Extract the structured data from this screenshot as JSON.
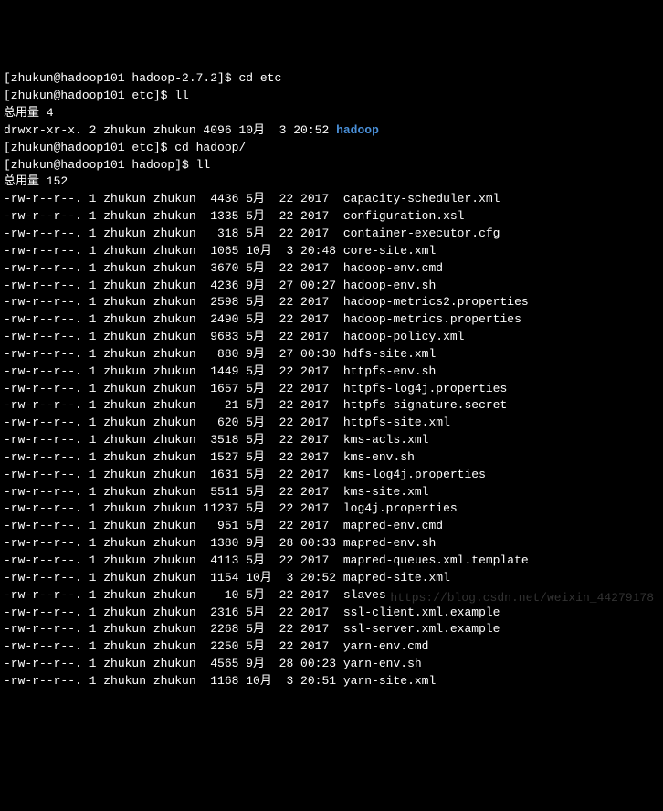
{
  "prompts": [
    {
      "user": "zhukun",
      "host": "hadoop101",
      "path": "hadoop-2.7.2",
      "cmd": "cd etc"
    },
    {
      "user": "zhukun",
      "host": "hadoop101",
      "path": "etc",
      "cmd": "ll"
    }
  ],
  "total1_label": "总用量 4",
  "dir_line": {
    "perm": "drwxr-xr-x.",
    "links": "2",
    "owner": "zhukun",
    "group": "zhukun",
    "size": "4096",
    "month": "10月",
    "day": " 3",
    "time": "20:52",
    "name": "hadoop"
  },
  "prompts2": [
    {
      "user": "zhukun",
      "host": "hadoop101",
      "path": "etc",
      "cmd": "cd hadoop/"
    },
    {
      "user": "zhukun",
      "host": "hadoop101",
      "path": "hadoop",
      "cmd": "ll"
    }
  ],
  "total2_label": "总用量 152",
  "files": [
    {
      "perm": "-rw-r--r--.",
      "links": "1",
      "owner": "zhukun",
      "group": "zhukun",
      "size": " 4436",
      "month": "5月 ",
      "day": "22",
      "time": "2017 ",
      "name": "capacity-scheduler.xml"
    },
    {
      "perm": "-rw-r--r--.",
      "links": "1",
      "owner": "zhukun",
      "group": "zhukun",
      "size": " 1335",
      "month": "5月 ",
      "day": "22",
      "time": "2017 ",
      "name": "configuration.xsl"
    },
    {
      "perm": "-rw-r--r--.",
      "links": "1",
      "owner": "zhukun",
      "group": "zhukun",
      "size": "  318",
      "month": "5月 ",
      "day": "22",
      "time": "2017 ",
      "name": "container-executor.cfg"
    },
    {
      "perm": "-rw-r--r--.",
      "links": "1",
      "owner": "zhukun",
      "group": "zhukun",
      "size": " 1065",
      "month": "10月",
      "day": " 3",
      "time": "20:48",
      "name": "core-site.xml"
    },
    {
      "perm": "-rw-r--r--.",
      "links": "1",
      "owner": "zhukun",
      "group": "zhukun",
      "size": " 3670",
      "month": "5月 ",
      "day": "22",
      "time": "2017 ",
      "name": "hadoop-env.cmd"
    },
    {
      "perm": "-rw-r--r--.",
      "links": "1",
      "owner": "zhukun",
      "group": "zhukun",
      "size": " 4236",
      "month": "9月 ",
      "day": "27",
      "time": "00:27",
      "name": "hadoop-env.sh"
    },
    {
      "perm": "-rw-r--r--.",
      "links": "1",
      "owner": "zhukun",
      "group": "zhukun",
      "size": " 2598",
      "month": "5月 ",
      "day": "22",
      "time": "2017 ",
      "name": "hadoop-metrics2.properties"
    },
    {
      "perm": "-rw-r--r--.",
      "links": "1",
      "owner": "zhukun",
      "group": "zhukun",
      "size": " 2490",
      "month": "5月 ",
      "day": "22",
      "time": "2017 ",
      "name": "hadoop-metrics.properties"
    },
    {
      "perm": "-rw-r--r--.",
      "links": "1",
      "owner": "zhukun",
      "group": "zhukun",
      "size": " 9683",
      "month": "5月 ",
      "day": "22",
      "time": "2017 ",
      "name": "hadoop-policy.xml"
    },
    {
      "perm": "-rw-r--r--.",
      "links": "1",
      "owner": "zhukun",
      "group": "zhukun",
      "size": "  880",
      "month": "9月 ",
      "day": "27",
      "time": "00:30",
      "name": "hdfs-site.xml"
    },
    {
      "perm": "-rw-r--r--.",
      "links": "1",
      "owner": "zhukun",
      "group": "zhukun",
      "size": " 1449",
      "month": "5月 ",
      "day": "22",
      "time": "2017 ",
      "name": "httpfs-env.sh"
    },
    {
      "perm": "-rw-r--r--.",
      "links": "1",
      "owner": "zhukun",
      "group": "zhukun",
      "size": " 1657",
      "month": "5月 ",
      "day": "22",
      "time": "2017 ",
      "name": "httpfs-log4j.properties"
    },
    {
      "perm": "-rw-r--r--.",
      "links": "1",
      "owner": "zhukun",
      "group": "zhukun",
      "size": "   21",
      "month": "5月 ",
      "day": "22",
      "time": "2017 ",
      "name": "httpfs-signature.secret"
    },
    {
      "perm": "-rw-r--r--.",
      "links": "1",
      "owner": "zhukun",
      "group": "zhukun",
      "size": "  620",
      "month": "5月 ",
      "day": "22",
      "time": "2017 ",
      "name": "httpfs-site.xml"
    },
    {
      "perm": "-rw-r--r--.",
      "links": "1",
      "owner": "zhukun",
      "group": "zhukun",
      "size": " 3518",
      "month": "5月 ",
      "day": "22",
      "time": "2017 ",
      "name": "kms-acls.xml"
    },
    {
      "perm": "-rw-r--r--.",
      "links": "1",
      "owner": "zhukun",
      "group": "zhukun",
      "size": " 1527",
      "month": "5月 ",
      "day": "22",
      "time": "2017 ",
      "name": "kms-env.sh"
    },
    {
      "perm": "-rw-r--r--.",
      "links": "1",
      "owner": "zhukun",
      "group": "zhukun",
      "size": " 1631",
      "month": "5月 ",
      "day": "22",
      "time": "2017 ",
      "name": "kms-log4j.properties"
    },
    {
      "perm": "-rw-r--r--.",
      "links": "1",
      "owner": "zhukun",
      "group": "zhukun",
      "size": " 5511",
      "month": "5月 ",
      "day": "22",
      "time": "2017 ",
      "name": "kms-site.xml"
    },
    {
      "perm": "-rw-r--r--.",
      "links": "1",
      "owner": "zhukun",
      "group": "zhukun",
      "size": "11237",
      "month": "5月 ",
      "day": "22",
      "time": "2017 ",
      "name": "log4j.properties"
    },
    {
      "perm": "-rw-r--r--.",
      "links": "1",
      "owner": "zhukun",
      "group": "zhukun",
      "size": "  951",
      "month": "5月 ",
      "day": "22",
      "time": "2017 ",
      "name": "mapred-env.cmd"
    },
    {
      "perm": "-rw-r--r--.",
      "links": "1",
      "owner": "zhukun",
      "group": "zhukun",
      "size": " 1380",
      "month": "9月 ",
      "day": "28",
      "time": "00:33",
      "name": "mapred-env.sh"
    },
    {
      "perm": "-rw-r--r--.",
      "links": "1",
      "owner": "zhukun",
      "group": "zhukun",
      "size": " 4113",
      "month": "5月 ",
      "day": "22",
      "time": "2017 ",
      "name": "mapred-queues.xml.template"
    },
    {
      "perm": "-rw-r--r--.",
      "links": "1",
      "owner": "zhukun",
      "group": "zhukun",
      "size": " 1154",
      "month": "10月",
      "day": " 3",
      "time": "20:52",
      "name": "mapred-site.xml"
    },
    {
      "perm": "-rw-r--r--.",
      "links": "1",
      "owner": "zhukun",
      "group": "zhukun",
      "size": "   10",
      "month": "5月 ",
      "day": "22",
      "time": "2017 ",
      "name": "slaves"
    },
    {
      "perm": "-rw-r--r--.",
      "links": "1",
      "owner": "zhukun",
      "group": "zhukun",
      "size": " 2316",
      "month": "5月 ",
      "day": "22",
      "time": "2017 ",
      "name": "ssl-client.xml.example"
    },
    {
      "perm": "-rw-r--r--.",
      "links": "1",
      "owner": "zhukun",
      "group": "zhukun",
      "size": " 2268",
      "month": "5月 ",
      "day": "22",
      "time": "2017 ",
      "name": "ssl-server.xml.example"
    },
    {
      "perm": "-rw-r--r--.",
      "links": "1",
      "owner": "zhukun",
      "group": "zhukun",
      "size": " 2250",
      "month": "5月 ",
      "day": "22",
      "time": "2017 ",
      "name": "yarn-env.cmd"
    },
    {
      "perm": "-rw-r--r--.",
      "links": "1",
      "owner": "zhukun",
      "group": "zhukun",
      "size": " 4565",
      "month": "9月 ",
      "day": "28",
      "time": "00:23",
      "name": "yarn-env.sh"
    },
    {
      "perm": "-rw-r--r--.",
      "links": "1",
      "owner": "zhukun",
      "group": "zhukun",
      "size": " 1168",
      "month": "10月",
      "day": " 3",
      "time": "20:51",
      "name": "yarn-site.xml"
    }
  ],
  "watermark": "https://blog.csdn.net/weixin_44279178"
}
